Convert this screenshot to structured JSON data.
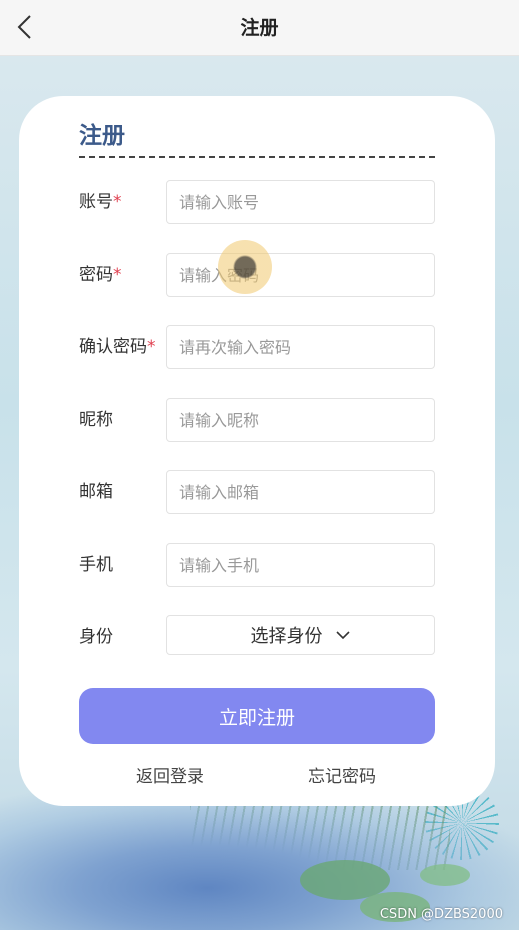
{
  "header": {
    "title": "注册",
    "back_icon": "chevron-left-icon"
  },
  "form": {
    "title": "注册",
    "fields": [
      {
        "label": "账号",
        "required": "*",
        "placeholder": "请输入账号"
      },
      {
        "label": "密码",
        "required": "*",
        "placeholder": "请输入密码"
      },
      {
        "label": "确认密码",
        "required": "*",
        "placeholder": "请再次输入密码"
      },
      {
        "label": "昵称",
        "placeholder": "请输入昵称"
      },
      {
        "label": "邮箱",
        "placeholder": "请输入邮箱"
      },
      {
        "label": "手机",
        "placeholder": "请输入手机"
      }
    ],
    "role": {
      "label": "身份",
      "value": "选择身份",
      "icon": "chevron-down-icon"
    },
    "submit_label": "立即注册",
    "back_login": "返回登录",
    "forgot_password": "忘记密码"
  },
  "colors": {
    "primary": "#8288f0",
    "title": "#3c5a8a",
    "required": "#e04050"
  },
  "watermark": "CSDN @DZBS2000"
}
